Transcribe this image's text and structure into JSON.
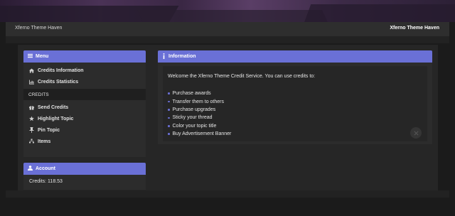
{
  "header": {
    "brand": "Xferno Theme Haven",
    "right_title": "Xferno Theme Haven"
  },
  "menu": {
    "title": "Menu",
    "items": [
      {
        "label": "Credits Information",
        "icon": "home-icon"
      },
      {
        "label": "Credits Statistics",
        "icon": "bar-chart-icon"
      }
    ],
    "section_label": "CREDITS",
    "credit_items": [
      {
        "label": "Send Credits",
        "icon": "gift-icon"
      },
      {
        "label": "Highlight Topic",
        "icon": "star-icon"
      },
      {
        "label": "Pin Topic",
        "icon": "pin-icon"
      },
      {
        "label": "Items",
        "icon": "sitemap-icon"
      }
    ]
  },
  "account": {
    "title": "Account",
    "credits": "Credits: 118.53"
  },
  "information": {
    "title": "Information",
    "welcome": "Welcome the Xferno Theme Credit Service. You can use credits to:",
    "uses": [
      "Purchase awards",
      "Transfer them to others",
      "Purchase upgrades",
      "Sticky your thread",
      "Color your topic title",
      "Buy Advertisement Banner"
    ]
  },
  "colors": {
    "accent": "#6a70d6",
    "panel": "#2c2c2c",
    "background": "#1b1b1b"
  }
}
